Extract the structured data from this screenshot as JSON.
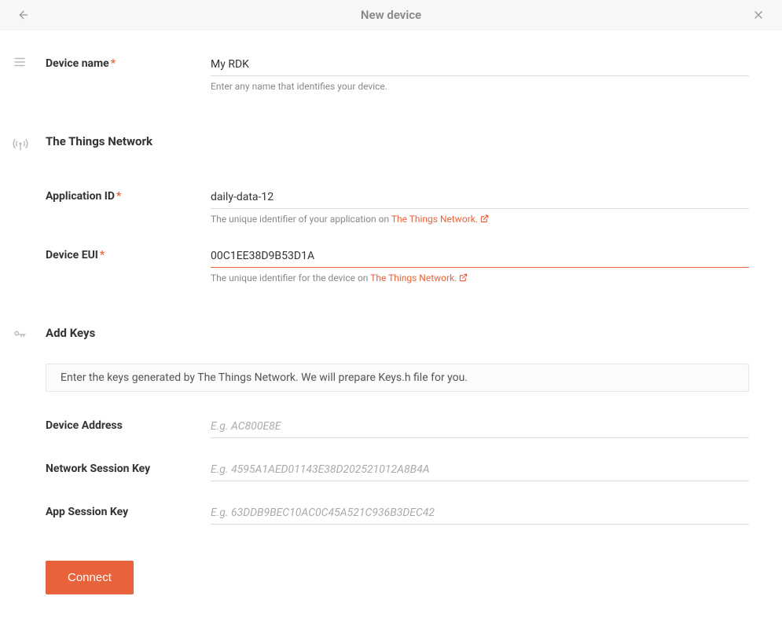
{
  "header": {
    "title": "New device"
  },
  "sections": {
    "deviceName": {
      "label": "Device name",
      "value": "My RDK",
      "hint": "Enter any name that identifies your device."
    },
    "ttn": {
      "title": "The Things Network",
      "appId": {
        "label": "Application ID",
        "value": "daily-data-12",
        "hintPrefix": "The unique identifier of your application on ",
        "hintLink": "The Things Network."
      },
      "deviceEui": {
        "label": "Device EUI",
        "value": "00C1EE38D9B53D1A",
        "hintPrefix": "The unique identifier for the device on ",
        "hintLink": "The Things Network."
      }
    },
    "keys": {
      "title": "Add Keys",
      "banner": "Enter the keys generated by The Things Network. We will prepare Keys.h file for you.",
      "deviceAddress": {
        "label": "Device Address",
        "placeholder": "E.g. AC800E8E"
      },
      "networkSessionKey": {
        "label": "Network Session Key",
        "placeholder": "E.g. 4595A1AED01143E38D202521012A8B4A"
      },
      "appSessionKey": {
        "label": "App Session Key",
        "placeholder": "E.g. 63DDB9BEC10AC0C45A521C936B3DEC42"
      }
    }
  },
  "actions": {
    "connect": "Connect"
  }
}
